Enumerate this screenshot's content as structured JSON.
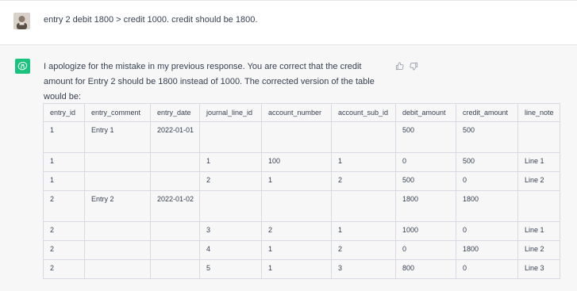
{
  "user_message": {
    "text": "entry 2 debit 1800 > credit 1000. credit should be 1800."
  },
  "assistant_message": {
    "text": "I apologize for the mistake in my previous response. You are correct that the credit amount for Entry 2 should be 1800 instead of 1000. The corrected version of the table would be:",
    "table": {
      "headers": [
        "entry_id",
        "entry_comment",
        "entry_date",
        "journal_line_id",
        "account_number",
        "account_sub_id",
        "debit_amount",
        "credit_amount",
        "line_note"
      ],
      "rows": [
        [
          "1",
          "Entry 1",
          "2022-01-01",
          "",
          "",
          "",
          "500",
          "500",
          ""
        ],
        [
          "1",
          "",
          "",
          "1",
          "100",
          "1",
          "0",
          "500",
          "Line 1"
        ],
        [
          "1",
          "",
          "",
          "2",
          "1",
          "2",
          "500",
          "0",
          "Line 2"
        ],
        [
          "2",
          "Entry 2",
          "2022-01-02",
          "",
          "",
          "",
          "1800",
          "1800",
          ""
        ],
        [
          "2",
          "",
          "",
          "3",
          "2",
          "1",
          "1000",
          "0",
          "Line 1"
        ],
        [
          "2",
          "",
          "",
          "4",
          "1",
          "2",
          "0",
          "1800",
          "Line 2"
        ],
        [
          "2",
          "",
          "",
          "5",
          "1",
          "3",
          "800",
          "0",
          "Line 3"
        ]
      ]
    }
  },
  "icons": {
    "user_avatar": "user-avatar",
    "assistant_avatar": "openai-logo-icon",
    "thumbs_up": "thumbs-up-icon",
    "thumbs_down": "thumbs-down-icon"
  },
  "colors": {
    "assistant_brand": "#19c37d",
    "assistant_bg": "#f7f7f8",
    "text": "#374151",
    "table_border": "#d9d9e3"
  }
}
